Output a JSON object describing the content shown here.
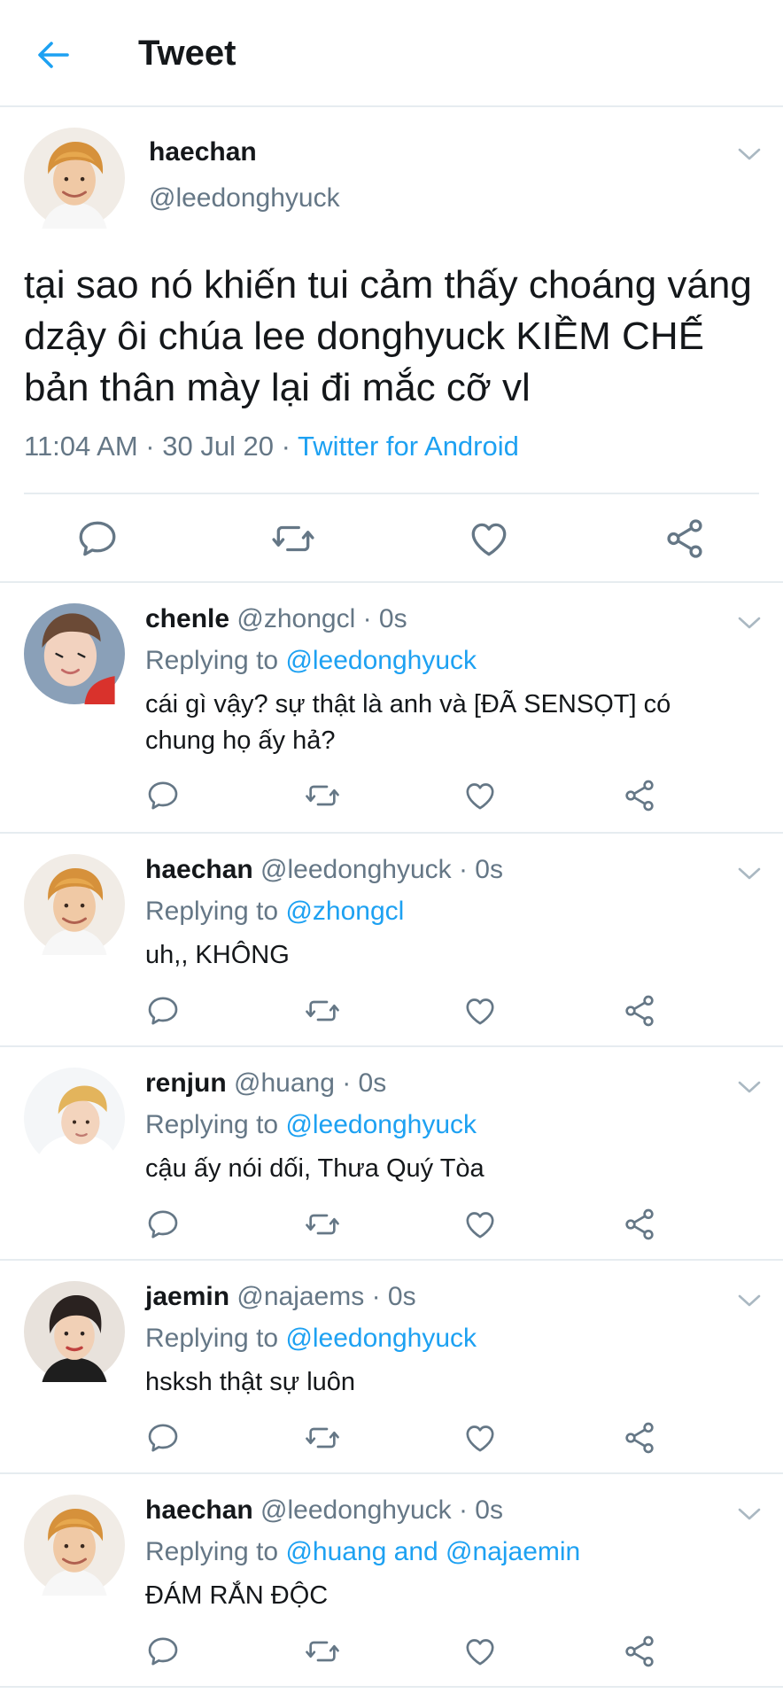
{
  "header": {
    "title": "Tweet",
    "back_icon": "arrow-left-icon"
  },
  "colors": {
    "accent": "#1da1f2",
    "muted": "#657786",
    "text": "#14171a",
    "divider": "#e6ecf0"
  },
  "main_tweet": {
    "name": "haechan",
    "handle": "@leedonghyuck",
    "text": "tại sao nó khiến tui cảm thấy choáng váng dzậy ôi chúa lee donghyuck KIỀM CHẾ bản thân mày lại đi mắc cỡ vl",
    "timestamp": "11:04 AM · 30 Jul 20 · ",
    "source": "Twitter for Android"
  },
  "replies": [
    {
      "name": "chenle",
      "handle_time": " @zhongcl · 0s",
      "replying_prefix": "Replying to ",
      "replying_to": "@leedonghyuck",
      "text": "cái gì vậy? sự thật là anh và [ĐÃ SENSỌT] có chung họ ấy hả?"
    },
    {
      "name": "haechan",
      "handle_time": " @leedonghyuck · 0s",
      "replying_prefix": "Replying to ",
      "replying_to": "@zhongcl",
      "text": "uh,, KHÔNG"
    },
    {
      "name": "renjun",
      "handle_time": " @huang · 0s",
      "replying_prefix": "Replying to ",
      "replying_to": "@leedonghyuck",
      "text": "cậu ấy nói dối, Thưa Quý Tòa"
    },
    {
      "name": "jaemin",
      "handle_time": " @najaems · 0s",
      "replying_prefix": "Replying to ",
      "replying_to": "@leedonghyuck",
      "text": "hsksh thật sự luôn"
    },
    {
      "name": "haechan",
      "handle_time": " @leedonghyuck · 0s",
      "replying_prefix": "Replying to ",
      "replying_to": "@huang and @najaemin",
      "text": "ĐÁM RẮN ĐỘC"
    }
  ]
}
